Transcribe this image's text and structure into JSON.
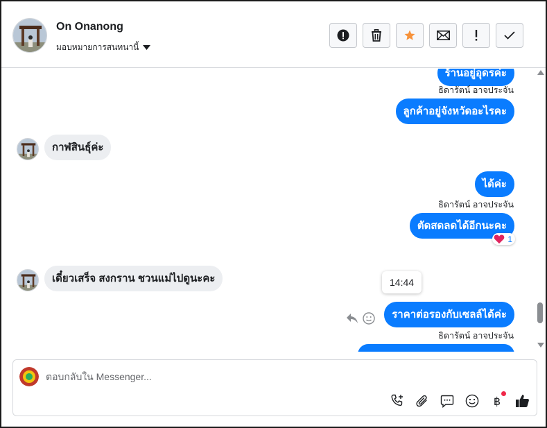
{
  "header": {
    "contact_name": "On Onanong",
    "subtitle": "มอบหมายการสนทนานี้",
    "actions": [
      {
        "name": "report-icon"
      },
      {
        "name": "trash-icon"
      },
      {
        "name": "star-icon"
      },
      {
        "name": "mail-icon"
      },
      {
        "name": "important-icon"
      },
      {
        "name": "check-icon"
      }
    ]
  },
  "messages": {
    "m1": {
      "text": "ร้านอยู่อุดรค่ะ",
      "sender": "ธิดารัตน์ อาจประจัน"
    },
    "m2": {
      "text": "ลูกค้าอยู่จังหวัดอะไรคะ"
    },
    "m3": {
      "text": "กาฬสินธุ์ค่ะ"
    },
    "m4": {
      "text": "ได้ค่ะ",
      "sender": "ธิดารัตน์ อาจประจัน"
    },
    "m5": {
      "text": "ตัดสดลดได้อีกนะคะ",
      "reaction_count": "1"
    },
    "m6": {
      "text": "เดี๋ยวเสร็จ สงกราน ชวนแม่ไปดูนะคะ"
    },
    "m7": {
      "text": "ราคาต่อรองกับเซลล์ได้ค่ะ",
      "sender": "ธิดารัตน์ อาจประจัน"
    },
    "tooltip_time": "14:44"
  },
  "reply": {
    "placeholder": "ตอบกลับใน Messenger...",
    "icons": [
      "call-add-icon",
      "attachment-icon",
      "saved-reply-icon",
      "emoji-icon",
      "baht-icon",
      "like-icon"
    ]
  },
  "colors": {
    "outgoing_bubble": "#0a7cff",
    "incoming_bubble": "#eceef1",
    "star": "#f7923a",
    "notification_dot": "#f02849"
  }
}
